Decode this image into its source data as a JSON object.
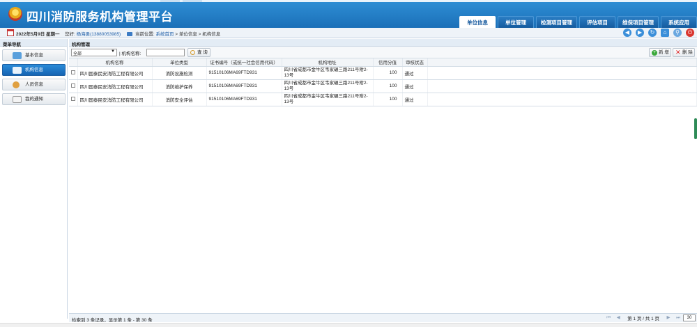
{
  "app": {
    "title": "四川消防服务机构管理平台"
  },
  "nav_tabs": [
    {
      "label": "单位信息",
      "active": true
    },
    {
      "label": "单位管理",
      "active": false
    },
    {
      "label": "检测项目管理",
      "active": false
    },
    {
      "label": "评估项目",
      "active": false
    },
    {
      "label": "维保项目管理",
      "active": false
    },
    {
      "label": "系统应用",
      "active": false
    }
  ],
  "infobar": {
    "date": "2022年5月9日 星期一",
    "greeting": "您好:",
    "user": "杨海勇(13880053985)",
    "location_label": "当前位置:",
    "location_home": "系统首页",
    "location_rest": " > 单位信息 > 机构信息"
  },
  "toolbar_icons": [
    "back-arrow-icon",
    "forward-arrow-icon",
    "refresh-icon",
    "home-icon",
    "search-icon",
    "power-icon"
  ],
  "sidebar": {
    "title": "菜单导航",
    "items": [
      {
        "label": "基本信息",
        "icon": "info-card-icon",
        "active": false
      },
      {
        "label": "机构信息",
        "icon": "org-card-icon",
        "active": true
      },
      {
        "label": "人员信息",
        "icon": "person-icon",
        "active": false
      },
      {
        "label": "我的通知",
        "icon": "notice-icon",
        "active": false
      }
    ]
  },
  "main": {
    "title": "机构管理",
    "filter_select": "全部",
    "filter_label": "| 机构名称:",
    "search_value": "",
    "search_button": "查 询",
    "add_button": "新 增",
    "delete_button": "删 除"
  },
  "table": {
    "headers": [
      "",
      "机构名称",
      "单位类型",
      "证书编号（或统一社会信用代码）",
      "机构地址",
      "信用分值",
      "审核状态"
    ],
    "rows": [
      {
        "name": "四川国泰民安消防工程有限公司",
        "type": "消防设施检测",
        "cert": "91510106MA69FTD931",
        "addr": "四川省成都市金牛区韦家碾三路211号附2-13号",
        "score": "100",
        "status": "通过"
      },
      {
        "name": "四川国泰民安消防工程有限公司",
        "type": "消防维护保养",
        "cert": "91510106MA69FTD931",
        "addr": "四川省成都市金牛区韦家碾三路211号附2-13号",
        "score": "100",
        "status": "通过"
      },
      {
        "name": "四川国泰民安消防工程有限公司",
        "type": "消防安全评估",
        "cert": "91510106MA69FTD931",
        "addr": "四川省成都市金牛区韦家碾三路211号附2-13号",
        "score": "100",
        "status": "通过"
      }
    ]
  },
  "footer": {
    "count_text": "检索到 3 条记录，显示第 1 条 - 第 30 条",
    "page_info": "第 1 页 / 共 1 页",
    "page_size": "30"
  },
  "colors": {
    "header": "#1b70b8",
    "active_side": "#1664b3"
  }
}
